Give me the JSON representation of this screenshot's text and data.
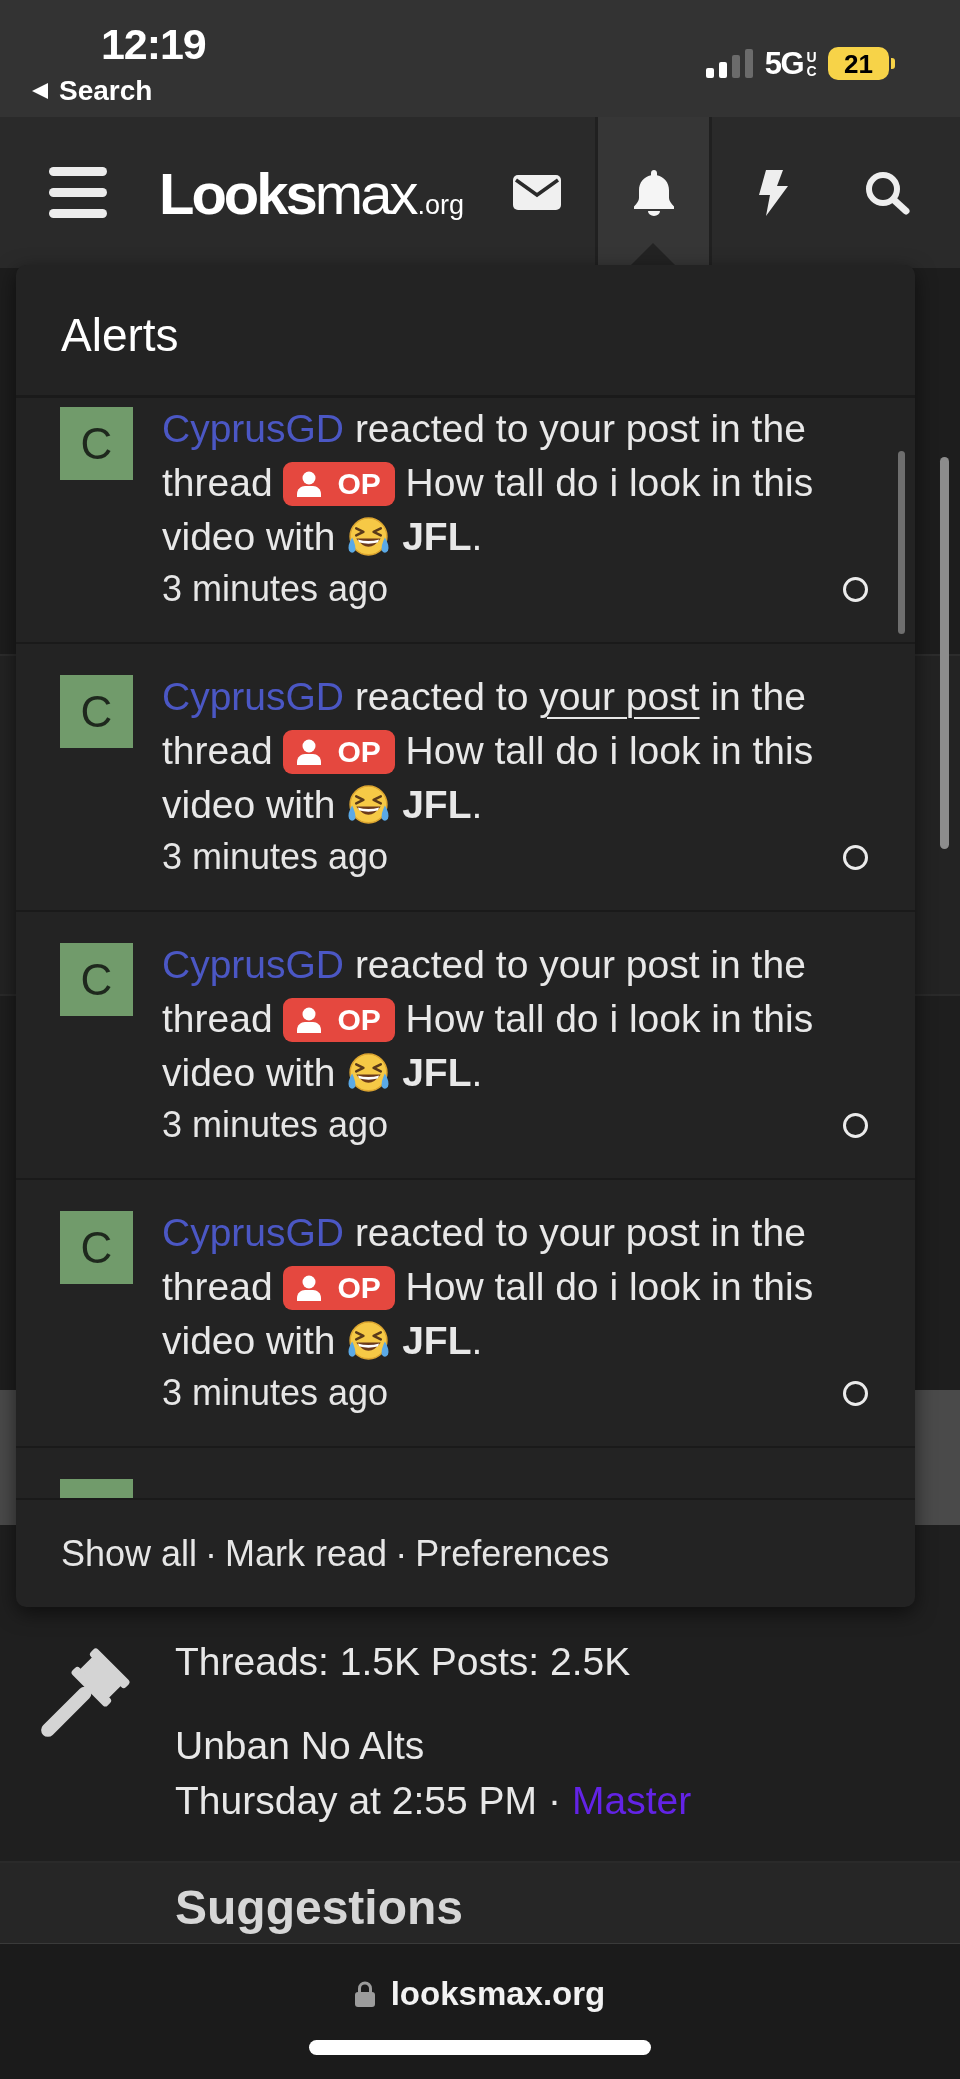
{
  "status_bar": {
    "time": "12:19",
    "back_label": "Search",
    "network": "5G",
    "network_badge": "UC",
    "battery": "21"
  },
  "header": {
    "logo": {
      "name": "**Looks**max",
      "domain": ".org"
    },
    "nav": [
      {
        "kind": "messages",
        "selected": false
      },
      {
        "kind": "alerts",
        "selected": true
      },
      {
        "kind": "whats_new",
        "selected": false
      },
      {
        "kind": "search",
        "selected": false
      }
    ]
  },
  "alerts_popup": {
    "title": "Alerts",
    "alerts": [
      {
        "avatar_letter": "C",
        "username": "CyprusGD",
        "text_before_link": "reacted to",
        "link": "your post",
        "link_hovered": false,
        "text_after_link": "in the thread",
        "prefix": "OP",
        "thread_title": "How tall do i look in this video",
        "text_before_reaction": "with",
        "reaction": "JFL",
        "end": ".",
        "time": "3 minutes ago",
        "unread": false
      },
      {
        "avatar_letter": "C",
        "username": "CyprusGD",
        "text_before_link": "reacted to",
        "link": "your post",
        "link_hovered": true,
        "text_after_link": "in the thread",
        "prefix": "OP",
        "thread_title": "How tall do i look in this video",
        "text_before_reaction": "with",
        "reaction": "JFL",
        "end": ".",
        "time": "3 minutes ago",
        "unread": false
      },
      {
        "avatar_letter": "C",
        "username": "CyprusGD",
        "text_before_link": "reacted to",
        "link": "your post",
        "link_hovered": false,
        "text_after_link": "in the thread",
        "prefix": "OP",
        "thread_title": "How tall do i look in this video",
        "text_before_reaction": "with",
        "reaction": "JFL",
        "end": ".",
        "time": "3 minutes ago",
        "unread": false
      },
      {
        "avatar_letter": "C",
        "username": "CyprusGD",
        "text_before_link": "reacted to",
        "link": "your post",
        "link_hovered": false,
        "text_after_link": "in the thread",
        "prefix": "OP",
        "thread_title": "How tall do i look in this video",
        "text_before_reaction": "with",
        "reaction": "JFL",
        "end": ".",
        "time": "3 minutes ago",
        "unread": false
      }
    ],
    "footer": {
      "links": [
        "Show all",
        "Mark read",
        "Preferences"
      ],
      "separator": "·"
    }
  },
  "forum_nodes": [
    {
      "stats": "Threads: 1.5K Posts: 2.5K",
      "last_thread": "Unban No Alts",
      "last_post_time": "Thursday at 2:55 PM",
      "separator": "·",
      "last_poster": "Master"
    },
    {
      "title": "Suggestions"
    }
  ],
  "address_bar": {
    "url": "looksmax.org"
  }
}
